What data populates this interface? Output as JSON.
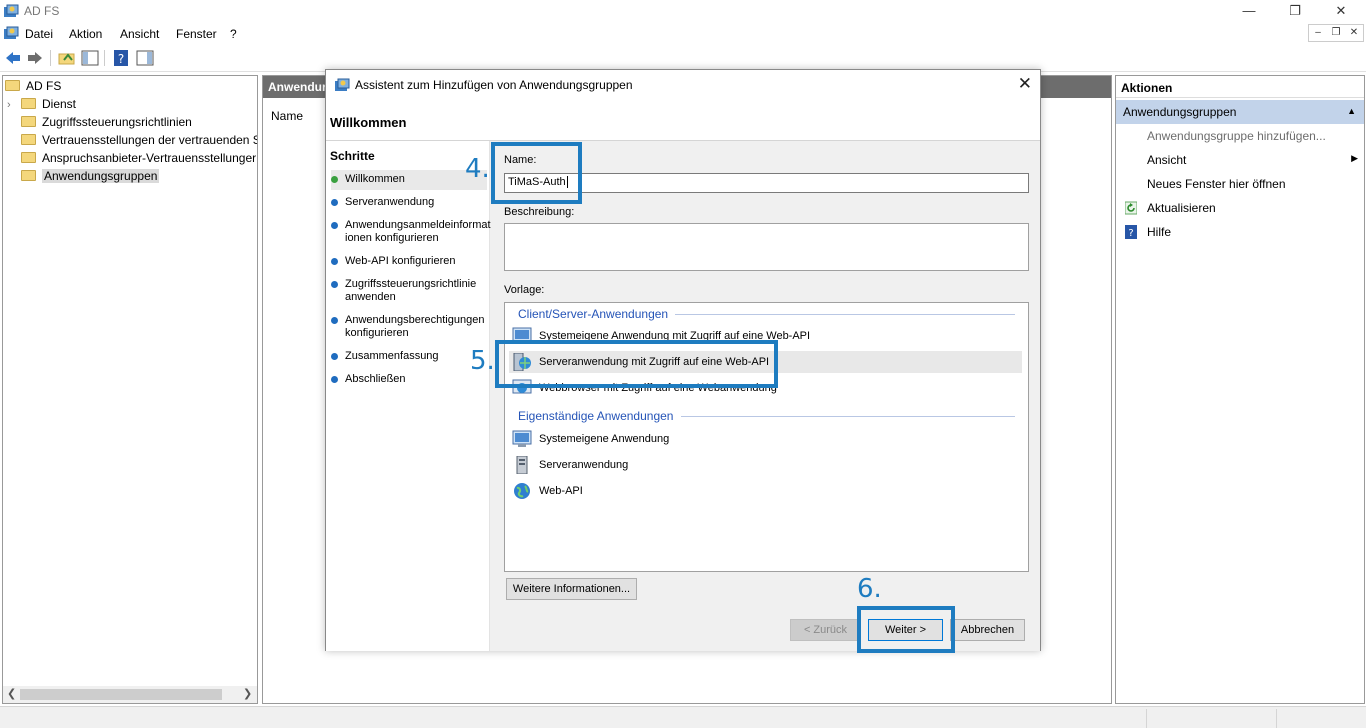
{
  "window": {
    "title": "AD FS"
  },
  "menu": [
    "Datei",
    "Aktion",
    "Ansicht",
    "Fenster",
    "?"
  ],
  "tree": {
    "root": "AD FS",
    "items": [
      "Dienst",
      "Zugriffssteuerungsrichtlinien",
      "Vertrauensstellungen der vertrauenden S",
      "Anspruchsanbieter-Vertrauensstellunger",
      "Anwendungsgruppen"
    ]
  },
  "middle": {
    "header": "Anwendur",
    "column": "Name"
  },
  "actions": {
    "header": "Aktionen",
    "section": "Anwendungsgruppen",
    "items": [
      "Anwendungsgruppe hinzufügen...",
      "Ansicht",
      "Neues Fenster hier öffnen",
      "Aktualisieren",
      "Hilfe"
    ]
  },
  "dialog": {
    "title": "Assistent zum Hinzufügen von Anwendungsgruppen",
    "heading": "Willkommen",
    "steps_header": "Schritte",
    "steps": [
      "Willkommen",
      "Serveranwendung",
      "Anwendungsanmeldeinformat ionen konfigurieren",
      "Web-API konfigurieren",
      "Zugriffssteuerungsrichtlinie anwenden",
      "Anwendungsberechtigungen konfigurieren",
      "Zusammenfassung",
      "Abschließen"
    ],
    "name_label": "Name:",
    "name_value": "TiMaS-Auth",
    "desc_label": "Beschreibung:",
    "template_label": "Vorlage:",
    "group1": "Client/Server-Anwendungen",
    "group1_items": [
      "Systemeigene Anwendung mit Zugriff auf eine Web-API",
      "Serveranwendung mit Zugriff auf eine Web-API",
      "Webbrowser mit Zugriff auf eine Webanwendung"
    ],
    "group2": "Eigenständige Anwendungen",
    "group2_items": [
      "Systemeigene Anwendung",
      "Serveranwendung",
      "Web-API"
    ],
    "more_info": "Weitere Informationen...",
    "back": "< Zurück",
    "next": "Weiter >",
    "cancel": "Abbrechen"
  },
  "annotations": [
    "4.",
    "5.",
    "6."
  ],
  "colors": {
    "annotation": "#1e7cc0",
    "selection": "#c2d3ea",
    "group_header": "#2554b7"
  }
}
